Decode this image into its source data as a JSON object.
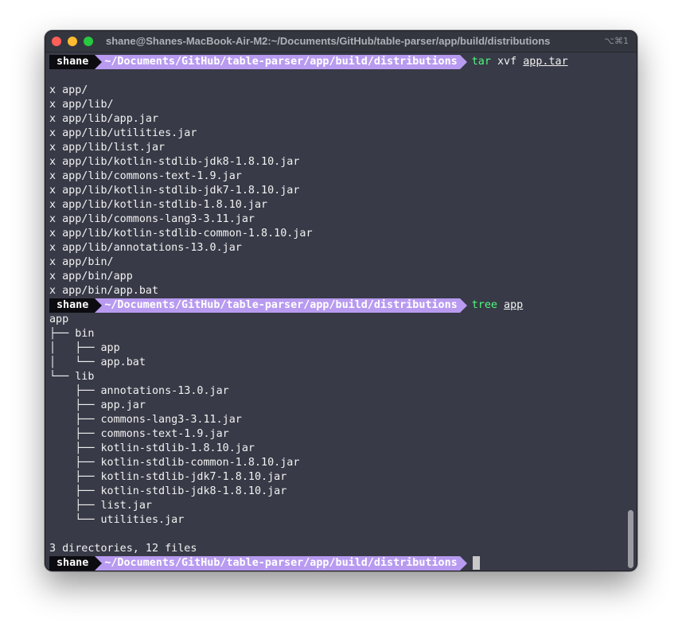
{
  "window": {
    "title": "shane@Shanes-MacBook-Air-M2:~/Documents/GitHub/table-parser/app/build/distributions",
    "shortcut": "⌥⌘1"
  },
  "prompt": {
    "user": "shane",
    "path": "~/Documents/GitHub/table-parser/app/build/distributions"
  },
  "commands": {
    "tar": {
      "name": "tar",
      "args": "xvf",
      "target": "app.tar"
    },
    "tree": {
      "name": "tree",
      "target": "app"
    }
  },
  "tar_output": [
    "x app/",
    "x app/lib/",
    "x app/lib/app.jar",
    "x app/lib/utilities.jar",
    "x app/lib/list.jar",
    "x app/lib/kotlin-stdlib-jdk8-1.8.10.jar",
    "x app/lib/commons-text-1.9.jar",
    "x app/lib/kotlin-stdlib-jdk7-1.8.10.jar",
    "x app/lib/kotlin-stdlib-1.8.10.jar",
    "x app/lib/commons-lang3-3.11.jar",
    "x app/lib/kotlin-stdlib-common-1.8.10.jar",
    "x app/lib/annotations-13.0.jar",
    "x app/bin/",
    "x app/bin/app",
    "x app/bin/app.bat"
  ],
  "tree_output": [
    "app",
    "├── bin",
    "│   ├── app",
    "│   └── app.bat",
    "└── lib",
    "    ├── annotations-13.0.jar",
    "    ├── app.jar",
    "    ├── commons-lang3-3.11.jar",
    "    ├── commons-text-1.9.jar",
    "    ├── kotlin-stdlib-1.8.10.jar",
    "    ├── kotlin-stdlib-common-1.8.10.jar",
    "    ├── kotlin-stdlib-jdk7-1.8.10.jar",
    "    ├── kotlin-stdlib-jdk8-1.8.10.jar",
    "    ├── list.jar",
    "    └── utilities.jar"
  ],
  "summary": "3 directories, 12 files",
  "colors": {
    "background": "#383a47",
    "prompt_user_bg": "#0c0c10",
    "prompt_path_bg": "#b89bf0",
    "command_name": "#50fa7b"
  }
}
